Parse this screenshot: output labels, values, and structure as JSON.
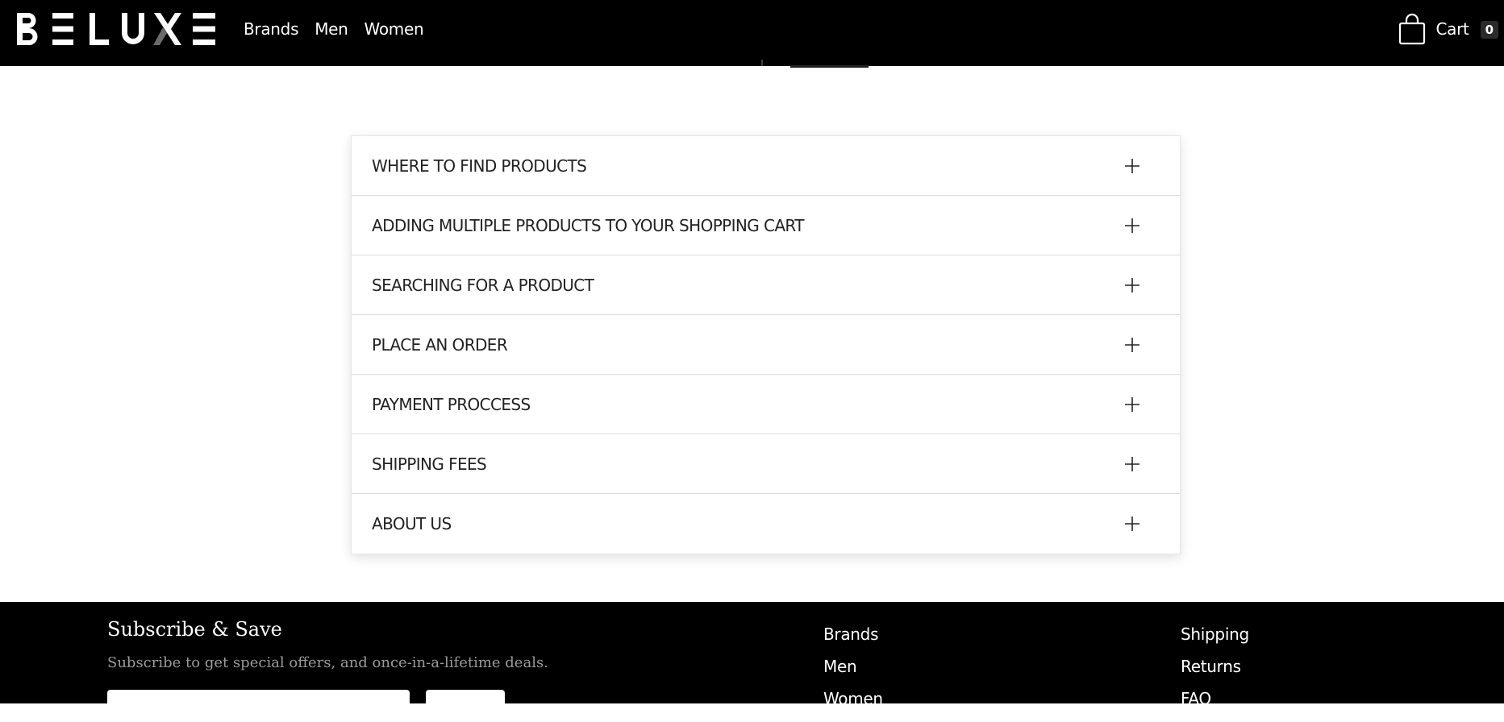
{
  "header": {
    "nav": [
      "Brands",
      "Men",
      "Women"
    ],
    "cart_label": "Cart",
    "cart_count": "0"
  },
  "faq": {
    "items": [
      "WHERE TO FIND PRODUCTS",
      "ADDING MULTIPLE PRODUCTS TO YOUR SHOPPING CART",
      "SEARCHING FOR A PRODUCT",
      "PLACE AN ORDER",
      "PAYMENT PROCCESS",
      "SHIPPING FEES",
      "ABOUT US"
    ]
  },
  "footer": {
    "subscribe_title": "Subscribe & Save",
    "subscribe_text": "Subscribe to get special offers, and once-in-a-lifetime deals.",
    "col1": [
      "Brands",
      "Men",
      "Women"
    ],
    "col2": [
      "Shipping",
      "Returns",
      "FAQ"
    ]
  },
  "colors": {
    "header_bg": "#000000",
    "footer_bg": "#000000",
    "accent_text": "#222222",
    "muted_text": "#9a9a9a"
  },
  "icons": {
    "logo": "beluxe-logo",
    "cart": "shopping-bag-icon",
    "expand": "plus-icon"
  }
}
